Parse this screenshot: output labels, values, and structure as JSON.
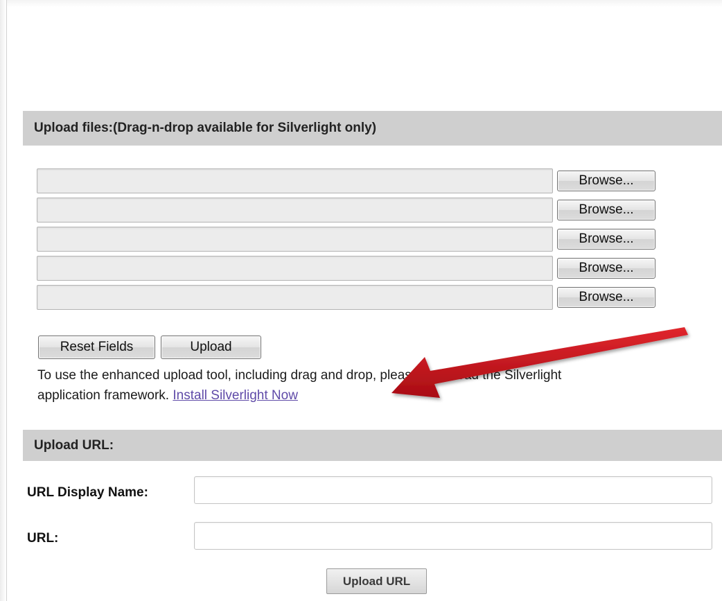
{
  "upload_files": {
    "header": "Upload files:(Drag-n-drop available for Silverlight only)",
    "browse_label": "Browse...",
    "file_rows": [
      {
        "value": ""
      },
      {
        "value": ""
      },
      {
        "value": ""
      },
      {
        "value": ""
      },
      {
        "value": ""
      }
    ],
    "reset_label": "Reset Fields",
    "upload_label": "Upload",
    "info_text": "To use the enhanced upload tool, including drag and drop, please download the Silverlight",
    "info_text_line2": "application framework.",
    "install_link": "Install Silverlight Now"
  },
  "upload_url": {
    "header": "Upload URL:",
    "display_name_label": "URL Display Name:",
    "display_name_value": "",
    "url_label": "URL:",
    "url_value": "",
    "submit_label": "Upload URL"
  },
  "colors": {
    "header_bg": "#cfcfcf",
    "link": "#5f4aa8",
    "annotation_arrow": "#c1121a"
  },
  "annotation": {
    "icon": "red-arrow-icon"
  }
}
